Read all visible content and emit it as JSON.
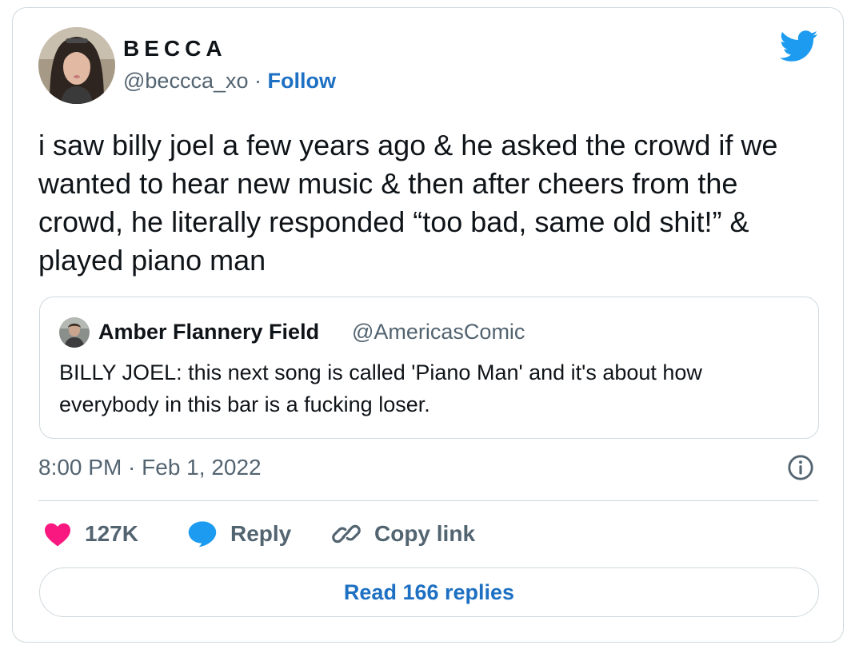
{
  "author": {
    "display_name": "BECCA",
    "handle": "@beccca_xo",
    "separator": "·",
    "follow_label": "Follow",
    "avatar_icon": "profile-photo"
  },
  "tweet": {
    "text": "i saw billy joel a few years ago & he asked the crowd if we wanted to hear new music & then after cheers from the crowd, he literally responded “too bad, same old shit!” & played piano man",
    "timestamp": "8:00 PM · Feb 1, 2022"
  },
  "quote": {
    "name": "Amber Flannery Field",
    "handle": "@AmericasComic",
    "text": "BILLY JOEL: this next song is called 'Piano Man' and it's about how everybody in this bar is a fucking loser."
  },
  "actions": {
    "like_count": "127K",
    "reply_label": "Reply",
    "copy_link_label": "Copy link",
    "read_replies_label": "Read 166 replies"
  },
  "colors": {
    "twitter_blue": "#1d9bf0",
    "link_blue": "#1d70c2",
    "like_pink": "#f91880",
    "muted_text": "#536471",
    "border": "#cfd9de"
  }
}
